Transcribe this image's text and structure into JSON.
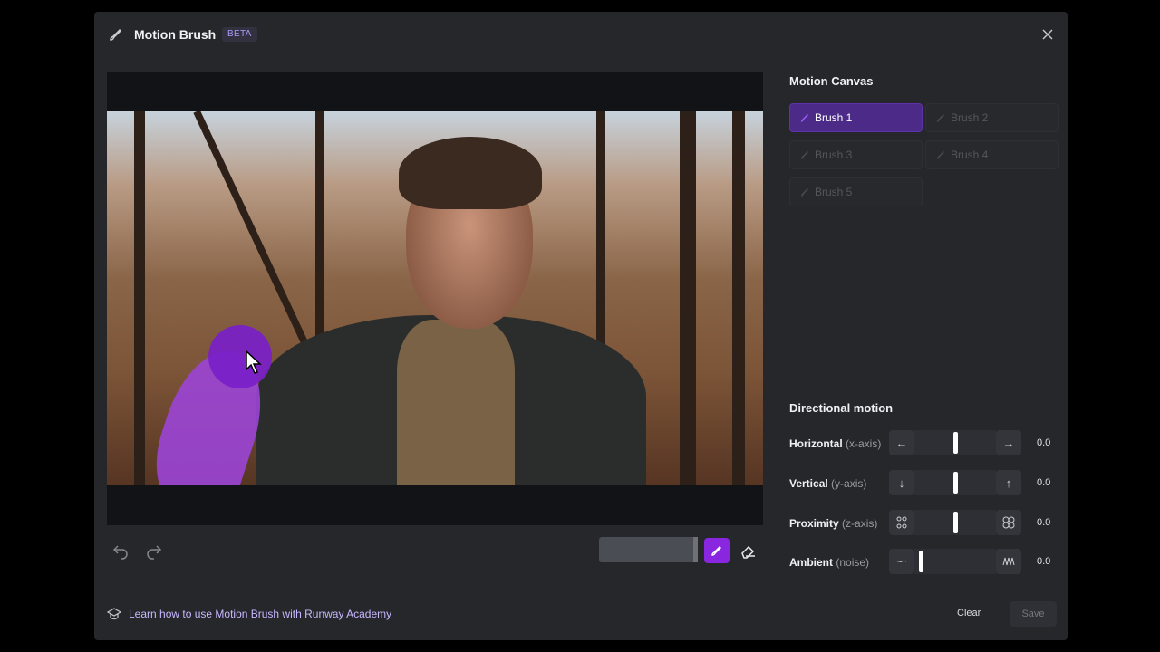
{
  "header": {
    "title": "Motion Brush",
    "badge": "BETA"
  },
  "canvas_tools": {
    "undo_icon": "undo-icon",
    "redo_icon": "redo-icon",
    "brush_icon": "paint-brush-icon",
    "eraser_icon": "eraser-icon"
  },
  "motion_canvas": {
    "title": "Motion Canvas",
    "brushes": [
      {
        "label": "Brush 1",
        "active": true,
        "color": "#8f3ff2"
      },
      {
        "label": "Brush 2",
        "active": false
      },
      {
        "label": "Brush 3",
        "active": false
      },
      {
        "label": "Brush 4",
        "active": false
      },
      {
        "label": "Brush 5",
        "active": false
      }
    ]
  },
  "directional_motion": {
    "title": "Directional motion",
    "rows": [
      {
        "name": "Horizontal",
        "axis": "(x-axis)",
        "left_icon": "arrow-left-icon",
        "right_icon": "arrow-right-icon",
        "value": "0.0"
      },
      {
        "name": "Vertical",
        "axis": "(y-axis)",
        "left_icon": "arrow-down-icon",
        "right_icon": "arrow-up-icon",
        "value": "0.0"
      },
      {
        "name": "Proximity",
        "axis": "(z-axis)",
        "left_icon": "zoom-out-icon",
        "right_icon": "zoom-in-icon",
        "value": "0.0"
      },
      {
        "name": "Ambient",
        "axis": "(noise)",
        "left_icon": "flat-line-icon",
        "right_icon": "wave-icon",
        "value": "0.0"
      }
    ]
  },
  "footer": {
    "link": "Learn how to use Motion Brush with Runway Academy",
    "clear": "Clear",
    "save": "Save"
  },
  "colors": {
    "accent": "#8826e0",
    "active_brush": "#4c2a88",
    "panel": "#26272b"
  }
}
